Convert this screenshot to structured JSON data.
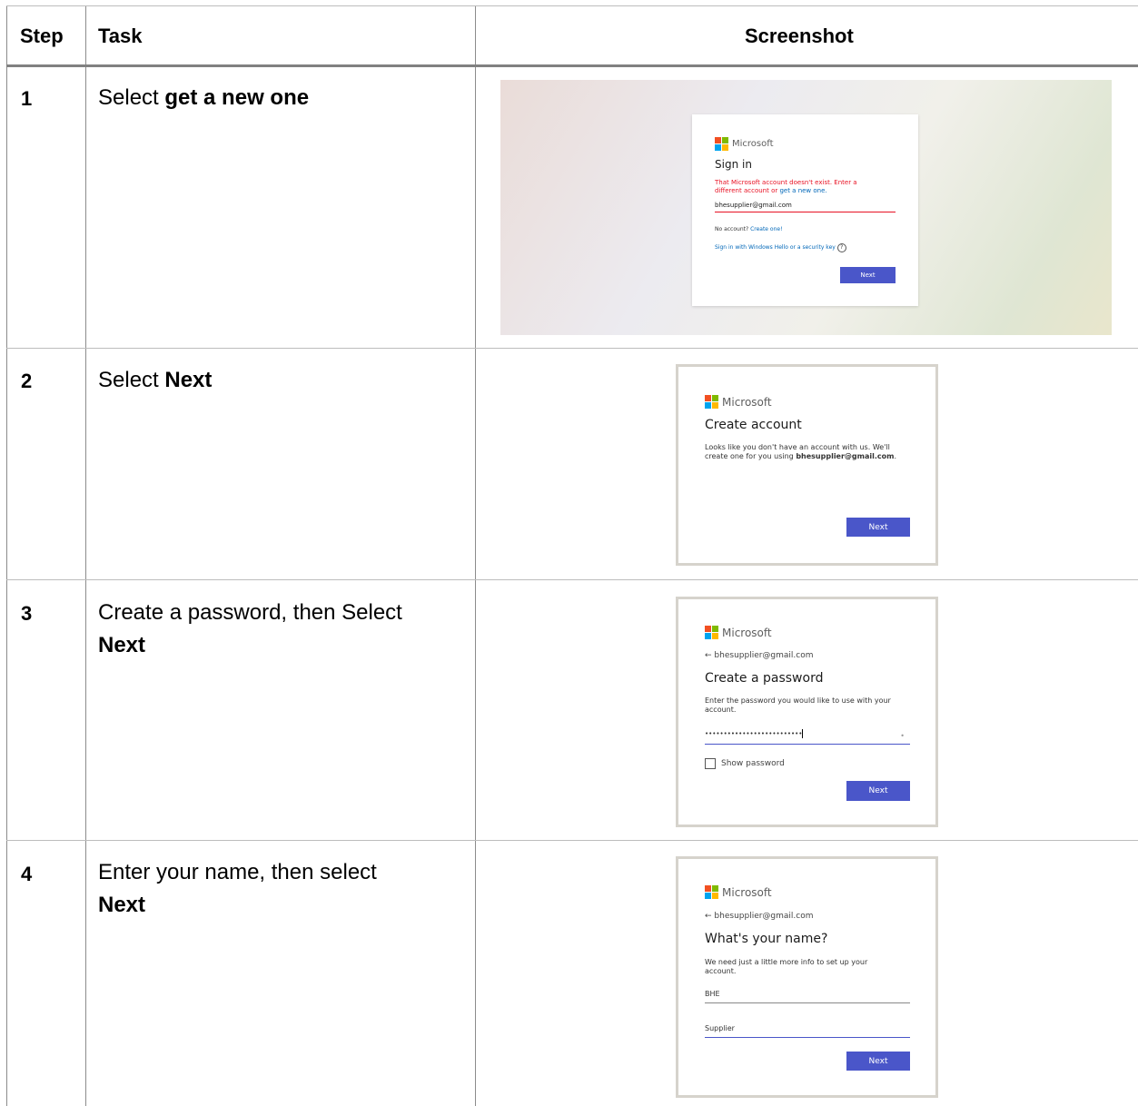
{
  "header": {
    "step": "Step",
    "task": "Task",
    "screenshot": "Screenshot"
  },
  "rows": [
    {
      "num": "1",
      "task_pre": "Select ",
      "task_bold": "get a new one",
      "task_mid": ""
    },
    {
      "num": "2",
      "task_pre": "Select ",
      "task_bold": "Next"
    },
    {
      "num": "3",
      "task_pre": "Create a password, then Select ",
      "task_bold": "Next"
    },
    {
      "num": "4",
      "task_pre": "Enter your name, then select ",
      "task_bold": "Next"
    }
  ],
  "shot1": {
    "brand": "Microsoft",
    "title": "Sign in",
    "error_line1": "That Microsoft account doesn't exist. Enter a",
    "error_line2_pre": "different account or ",
    "error_link": "get a new one.",
    "email": "bhesupplier@gmail.com",
    "no_account": "No account? ",
    "create_one": "Create one!",
    "hello_link": "Sign in with Windows Hello or a security key",
    "help_icon": "?",
    "next": "Next"
  },
  "shot2": {
    "brand": "Microsoft",
    "title": "Create account",
    "body_line1": "Looks like you don't have an account with us. We'll",
    "body_line2_pre": "create one for you using ",
    "body_email": "bhesupplier@gmail.com",
    "body_end": ".",
    "next": "Next"
  },
  "shot3": {
    "brand": "Microsoft",
    "back_email": "bhesupplier@gmail.com",
    "title": "Create a password",
    "body_line1": "Enter the password you would like to use with your",
    "body_line2": "account.",
    "password_mask": "••••••••••••••••••••••••••",
    "show_password": "Show password",
    "next": "Next"
  },
  "shot4": {
    "brand": "Microsoft",
    "back_email": "bhesupplier@gmail.com",
    "title": "What's your name?",
    "body_line1": "We need just a little more info to set up your",
    "body_line2": "account.",
    "first_name": "BHE",
    "last_name": "Supplier",
    "next": "Next"
  }
}
